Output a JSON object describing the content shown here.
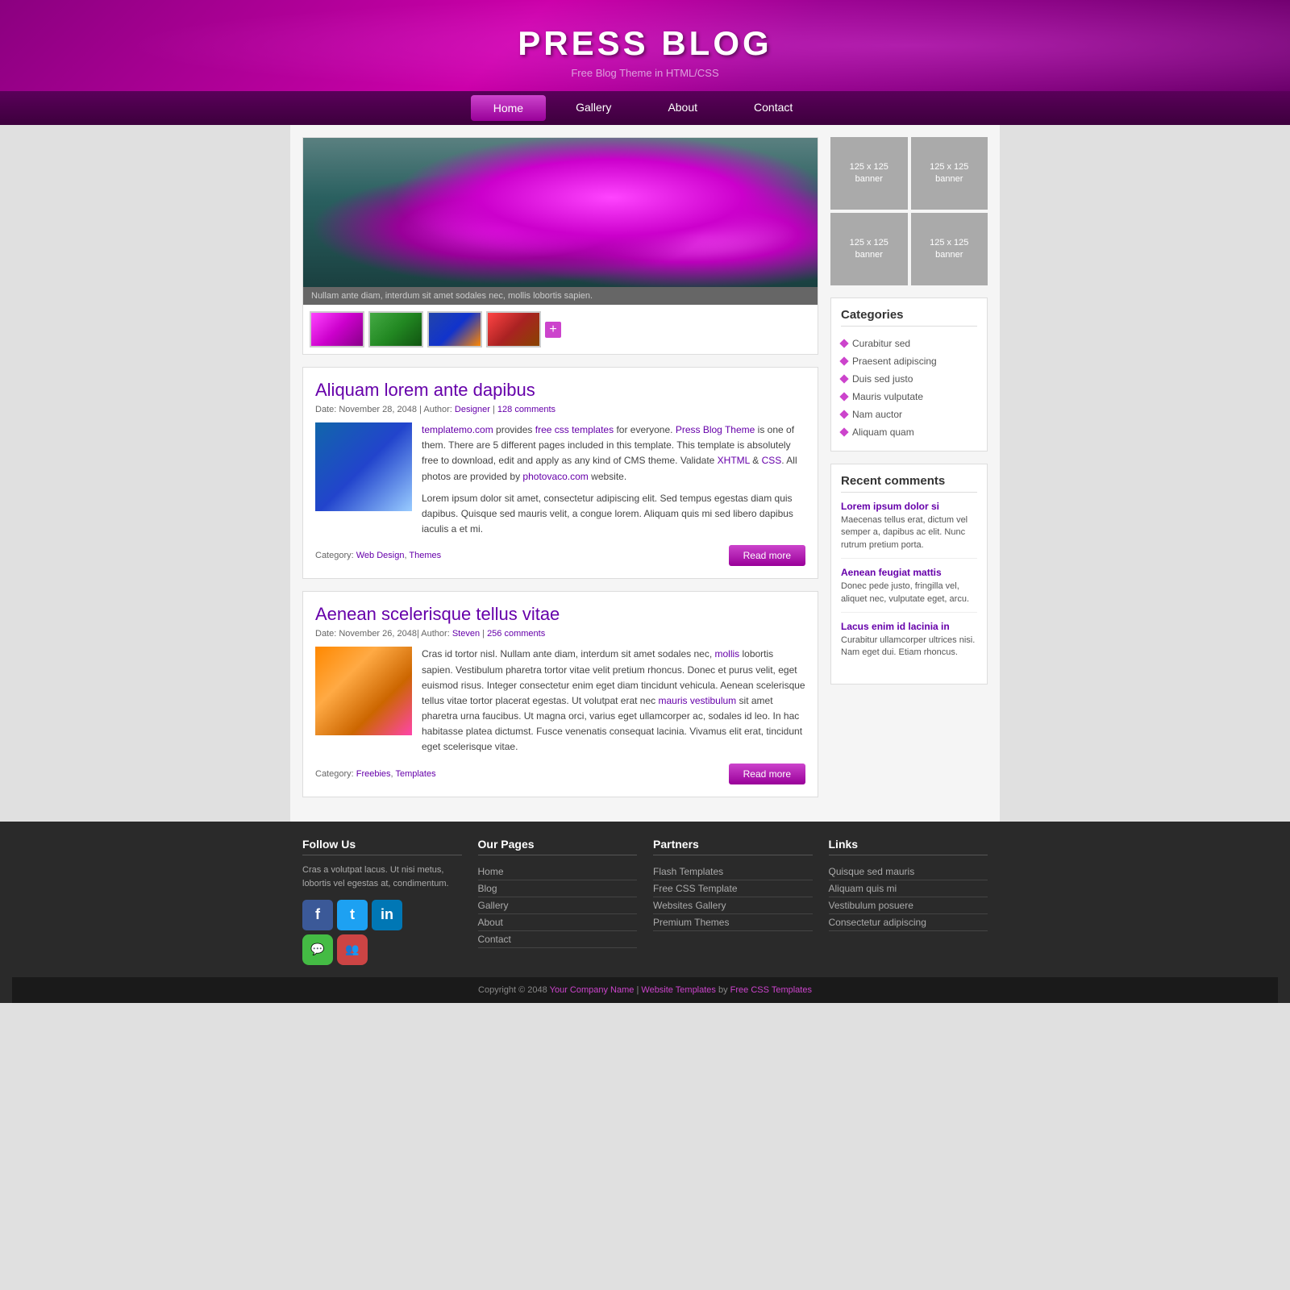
{
  "header": {
    "title": "PRESS BLOG",
    "subtitle": "Free Blog Theme in HTML/CSS"
  },
  "nav": {
    "items": [
      {
        "label": "Home",
        "active": true
      },
      {
        "label": "Gallery",
        "active": false
      },
      {
        "label": "About",
        "active": false
      },
      {
        "label": "Contact",
        "active": false
      }
    ]
  },
  "slider": {
    "caption": "Nullam ante diam, interdum sit amet sodales nec, mollis lobortis sapien.",
    "plus_label": "+"
  },
  "posts": [
    {
      "title": "Aliquam lorem ante dapibus",
      "date": "November 28, 2048",
      "author": "Designer",
      "comments": "128 comments",
      "text1": "templatemo.com provides free css templates for everyone. Press Blog Theme is one of them. There are 5 different pages included in this template. This template is absolutely free to download, edit and apply as any kind of CMS theme. Validate XHTML & CSS. All photos are provided by photovaco.com website.",
      "text2": "Lorem ipsum dolor sit amet, consectetur adipiscing elit. Sed tempus egestas diam quis dapibus. Quisque sed mauris velit, a congue lorem. Aliquam quis mi sed libero dapibus iaculis a et mi.",
      "link1": "templatemo.com",
      "link2": "free css templates",
      "link3": "Press Blog Theme",
      "link4": "XHTML",
      "link5": "CSS",
      "link6": "photovaco.com",
      "category1": "Web Design",
      "category2": "Themes",
      "read_more": "Read more"
    },
    {
      "title": "Aenean scelerisque tellus vitae",
      "date": "November 26, 2048",
      "author": "Steven",
      "comments": "256 comments",
      "text": "Cras id tortor nisl. Nullam ante diam, interdum sit amet sodales nec, mollis lobortis sapien. Vestibulum pharetra tortor vitae velit pretium rhoncus. Donec et purus velit, eget euismod risus. Integer consectetur enim eget diam tincidunt vehicula. Aenean scelerisque tellus vitae tortor placerat egestas. Ut volutpat erat nec mauris vestibulum sit amet pharetra urna faucibus. Ut magna orci, varius eget ullamcorper ac, sodales id leo. In hac habitasse platea dictumst. Fusce venenatis consequat lacinia. Vivamus elit erat, tincidunt eget scelerisque vitae.",
      "link1": "mollis",
      "link2": "mauris vestibulum",
      "category1": "Freebies",
      "category2": "Templates",
      "read_more": "Read more"
    }
  ],
  "sidebar": {
    "banners": [
      {
        "label": "125 x 125\nbanner"
      },
      {
        "label": "125 x 125\nbanner"
      },
      {
        "label": "125 x 125\nbanner"
      },
      {
        "label": "125 x 125\nbanner"
      }
    ],
    "categories": {
      "title": "Categories",
      "items": [
        "Curabitur sed",
        "Praesent adipiscing",
        "Duis sed justo",
        "Mauris vulputate",
        "Nam auctor",
        "Aliquam quam"
      ]
    },
    "recent_comments": {
      "title": "Recent comments",
      "items": [
        {
          "title": "Lorem ipsum dolor si",
          "text": "Maecenas tellus erat, dictum vel semper a, dapibus ac elit. Nunc rutrum pretium porta."
        },
        {
          "title": "Aenean feugiat mattis",
          "text": "Donec pede justo, fringilla vel, aliquet nec, vulputate eget, arcu."
        },
        {
          "title": "Lacus enim id lacinia in",
          "text": "Curabitur ullamcorper ultrices nisi. Nam eget dui. Etiam rhoncus."
        }
      ]
    }
  },
  "footer": {
    "follow_us": {
      "title": "Follow Us",
      "text": "Cras a volutpat lacus. Ut nisi metus, lobortis vel egestas at, condimentum.",
      "socials": [
        "f",
        "t",
        "in",
        "💬",
        "👥"
      ]
    },
    "our_pages": {
      "title": "Our Pages",
      "items": [
        "Home",
        "Blog",
        "Gallery",
        "About",
        "Contact"
      ]
    },
    "partners": {
      "title": "Partners",
      "items": [
        "Flash Templates",
        "Free CSS Template",
        "Websites Gallery",
        "Premium Themes"
      ]
    },
    "links": {
      "title": "Links",
      "items": [
        "Quisque sed mauris",
        "Aliquam quis mi",
        "Vestibulum posuere",
        "Consectetur adipiscing"
      ]
    },
    "copyright": "Copyright © 2048",
    "company": "Your Company Name",
    "website_templates": "Website Templates",
    "by": "by",
    "free_css": "Free CSS Templates"
  }
}
